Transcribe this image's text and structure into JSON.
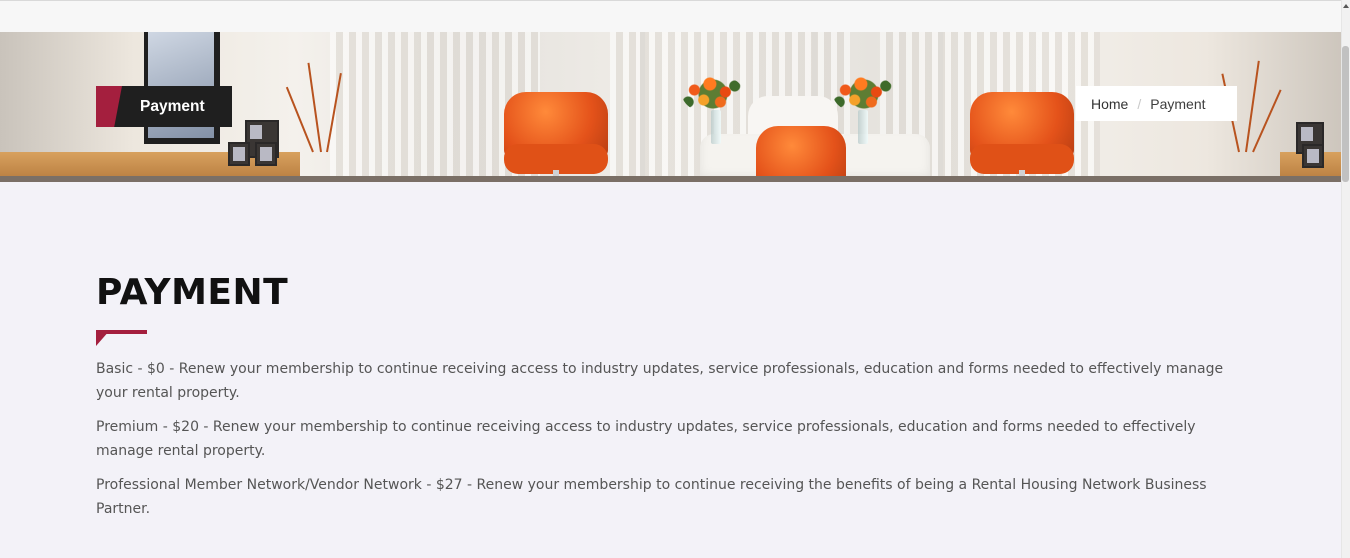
{
  "page_badge": {
    "label": "Payment"
  },
  "breadcrumb": {
    "home": "Home",
    "separator": "/",
    "current": "Payment"
  },
  "main": {
    "title": "PAYMENT",
    "plans": [
      "Basic - $0 - Renew your membership to continue receiving access to industry updates, service professionals, education and forms needed to effectively manage your rental property.",
      "Premium - $20 - Renew your membership to continue receiving access to industry updates, service professionals, education and forms needed to effectively manage rental property.",
      "Professional Member Network/Vendor Network - $27 - Renew your membership to continue receiving the benefits of being a Rental Housing Network Business Partner."
    ]
  },
  "colors": {
    "accent": "#a41f3e",
    "badge_bg": "#1f1f1f",
    "page_bg": "#f3f2f8",
    "text": "#555555"
  },
  "icons": {
    "scroll_up": "triangle-up-icon"
  }
}
